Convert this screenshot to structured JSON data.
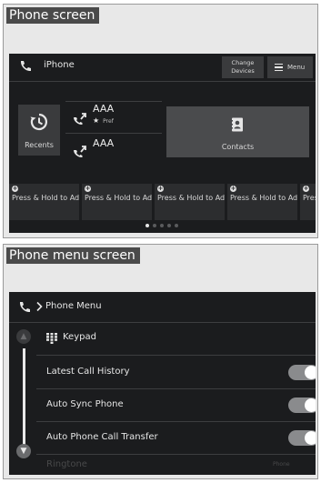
{
  "sections": {
    "phone_screen": {
      "caption": "Phone screen",
      "device_name": "iPhone",
      "change_devices_label": "Change Devices",
      "menu_label": "Menu",
      "recents_label": "Recents",
      "favorites": [
        {
          "name": "AAA",
          "tag": "Pref"
        },
        {
          "name": "AAA"
        }
      ],
      "contacts_label": "Contacts",
      "quick_slots": [
        "Press & Hold to Add",
        "Press & Hold to Add",
        "Press & Hold to Add",
        "Press & Hold to Add",
        "Press & Hold to Add"
      ],
      "page_count": 5,
      "active_page": 1
    },
    "phone_menu_screen": {
      "caption": "Phone menu screen",
      "breadcrumb_title": "Phone Menu",
      "items": [
        {
          "label": "Keypad"
        },
        {
          "label": "Latest Call History",
          "toggle": true
        },
        {
          "label": "Auto Sync Phone",
          "toggle": true
        },
        {
          "label": "Auto Phone Call Transfer",
          "toggle": true
        },
        {
          "label": "Ringtone",
          "value": "Phone"
        }
      ]
    }
  },
  "colors": {
    "screen_bg": "#1b1c1e",
    "tile_bg": "#3a3b3d",
    "caption_bg": "#4a4a4a",
    "panel_bg": "#e8e8e8"
  },
  "icons": [
    "phone-icon",
    "menu-icon",
    "history-icon",
    "missed-call-icon",
    "contacts-icon",
    "keypad-icon",
    "chevron-right-icon",
    "scroll-up-icon",
    "scroll-down-icon"
  ]
}
